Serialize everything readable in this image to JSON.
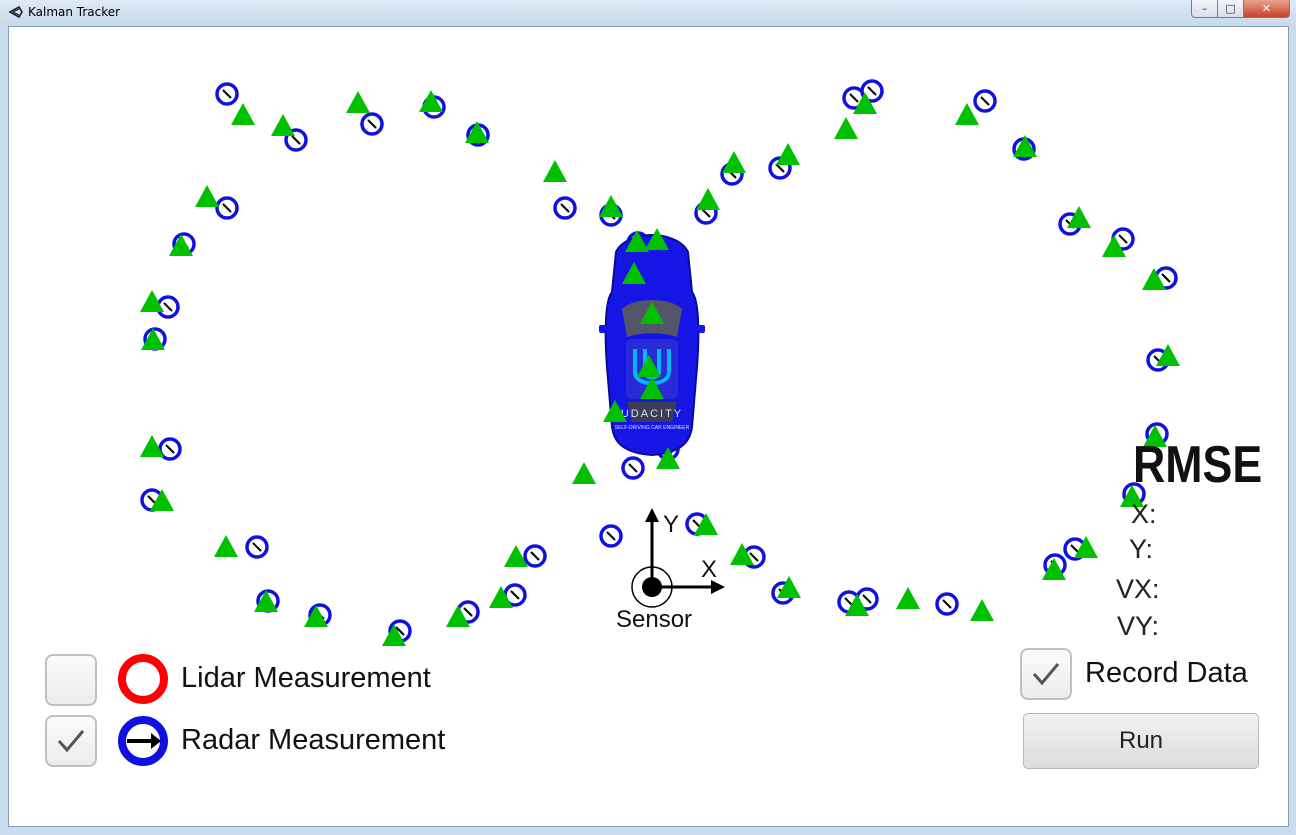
{
  "window": {
    "title": "Kalman Tracker",
    "minimize_glyph": "–",
    "maximize_glyph": "□",
    "close_glyph": "✕"
  },
  "scene": {
    "axis_y_label": "Y",
    "axis_x_label": "X",
    "sensor_label": "Sensor",
    "car_brand": "UDACITY",
    "car_subtitle": "SELF-DRIVING CAR ENGINEER",
    "colors": {
      "radar": "#1010e0",
      "lidar": "#ff0000",
      "estimate": "#00c000",
      "car": "#1515e6"
    }
  },
  "legend": {
    "lidar": {
      "label": "Lidar Measurement",
      "checked": false,
      "icon": "red-ring-icon"
    },
    "radar": {
      "label": "Radar Measurement",
      "checked": true,
      "icon": "blue-ring-arrow-icon"
    }
  },
  "rmse": {
    "title": "RMSE",
    "x": "X:",
    "y": "Y:",
    "vx": "VX:",
    "vy": "VY:"
  },
  "controls": {
    "record_label": "Record Data",
    "record_checked": true,
    "run_label": "Run"
  }
}
